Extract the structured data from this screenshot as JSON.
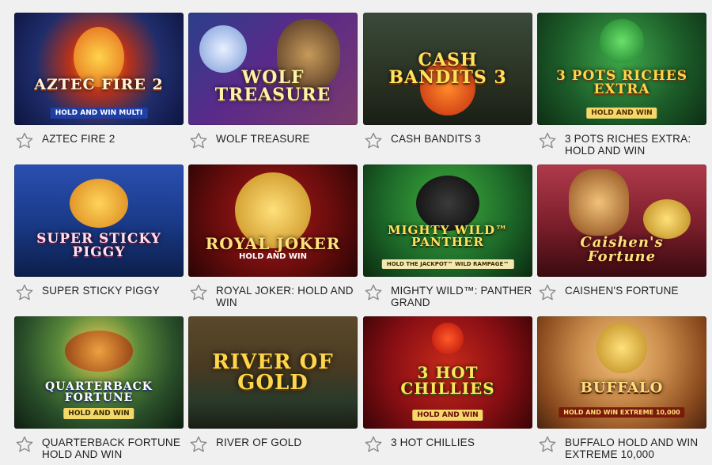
{
  "games": [
    {
      "name": "AZTEC FIRE 2",
      "art_title": "AZTEC FIRE 2",
      "art_sub": "HOLD AND WIN MULTI",
      "bg": "#1f2d6b",
      "accent": "#f7a21b"
    },
    {
      "name": "WOLF TREASURE",
      "art_title": "WOLF TREASURE",
      "art_sub": "",
      "bg": "#3a2a6e",
      "accent": "#f3c64a"
    },
    {
      "name": "CASH BANDITS 3",
      "art_title": "CASH BANDITS 3",
      "art_sub": "",
      "bg": "#2e3a2a",
      "accent": "#e8c13a"
    },
    {
      "name": "3 POTS RICHES EXTRA: HOLD AND WIN",
      "art_title": "3 POTS RICHES EXTRA",
      "art_sub": "HOLD AND WIN",
      "bg": "#1d5e2a",
      "accent": "#f0b42a"
    },
    {
      "name": "SUPER STICKY PIGGY",
      "art_title": "SUPER STICKY PIGGY",
      "art_sub": "",
      "bg": "#1a3b8a",
      "accent": "#f1b436"
    },
    {
      "name": "ROYAL JOKER: HOLD AND WIN",
      "art_title": "ROYAL JOKER",
      "art_sub": "HOLD AND WIN",
      "bg": "#6b0d0d",
      "accent": "#f2c03d"
    },
    {
      "name": "MIGHTY WILD™: PANTHER GRAND",
      "art_title": "MIGHTY WILD™ PANTHER",
      "art_sub": "HOLD THE JACKPOT™ WILD RAMPAGE™",
      "bg": "#1e6b2a",
      "accent": "#f3d148"
    },
    {
      "name": "CAISHEN'S FORTUNE",
      "art_title": "Caishen's Fortune",
      "art_sub": "",
      "bg": "#7a1e2a",
      "accent": "#f3c23b"
    },
    {
      "name": "QUARTERBACK FORTUNE HOLD AND WIN",
      "art_title": "QUARTERBACK FORTUNE",
      "art_sub": "HOLD AND WIN",
      "bg": "#2a4f2a",
      "accent": "#f0a51f"
    },
    {
      "name": "RIVER OF GOLD",
      "art_title": "RIVER OF GOLD",
      "art_sub": "",
      "bg": "#4a3a22",
      "accent": "#f2c23d"
    },
    {
      "name": "3 HOT CHILLIES",
      "art_title": "3 HOT CHILLIES",
      "art_sub": "HOLD AND WIN",
      "bg": "#8a0f14",
      "accent": "#f5d23a"
    },
    {
      "name": "BUFFALO HOLD AND WIN EXTREME 10,000",
      "art_title": "BUFFALO",
      "art_sub": "HOLD AND WIN EXTREME 10,000",
      "bg": "#b36a2e",
      "accent": "#f3c23b"
    }
  ]
}
